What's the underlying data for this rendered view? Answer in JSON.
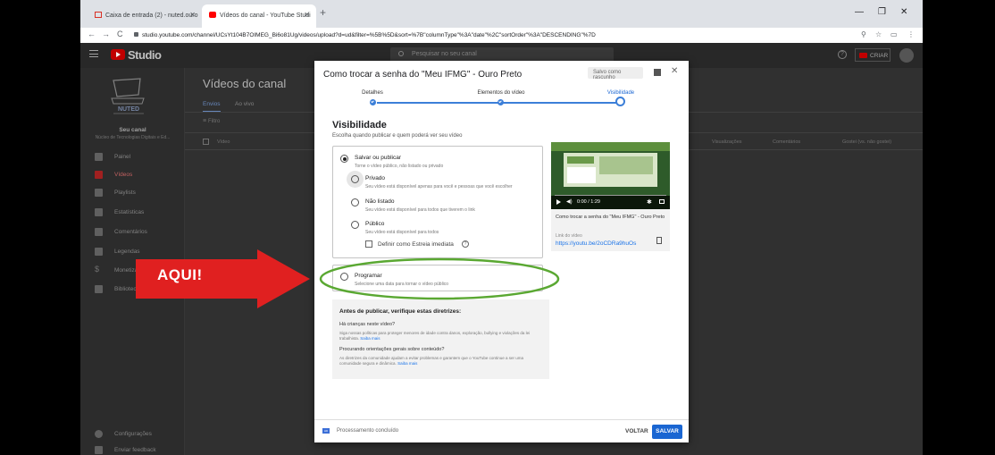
{
  "browser": {
    "tabs": [
      {
        "label": "Caixa de entrada (2) - nuted.ouro"
      },
      {
        "label": "Vídeos do canal - YouTube Studi"
      }
    ],
    "url": "studio.youtube.com/channel/UCsYt104B7OIMEG_Bi6o81Ug/videos/upload?d=ud&filter=%5B%5D&sort=%7B\"columnType\"%3A\"date\"%2C\"sortOrder\"%3A\"DESCENDING\"%7D"
  },
  "studio": {
    "brand": "Studio",
    "search_placeholder": "Pesquisar no seu canal",
    "create_label": "CRIAR"
  },
  "sidebar": {
    "channel_label": "Seu canal",
    "channel_name": "Núcleo de Tecnologias Digitais e Ed...",
    "logo_text": "NUTED",
    "items": [
      {
        "label": "Painel"
      },
      {
        "label": "Vídeos"
      },
      {
        "label": "Playlists"
      },
      {
        "label": "Estatísticas"
      },
      {
        "label": "Comentários"
      },
      {
        "label": "Legendas"
      },
      {
        "label": "Monetização"
      },
      {
        "label": "Biblioteca de áudio"
      }
    ],
    "bottom_items": [
      {
        "label": "Configurações"
      },
      {
        "label": "Enviar feedback"
      }
    ]
  },
  "content": {
    "title": "Vídeos do canal",
    "tabs": [
      {
        "label": "Envios"
      },
      {
        "label": "Ao vivo"
      }
    ],
    "filter_label": "Filtro",
    "columns": [
      "Vídeo",
      "Visualizações",
      "Comentários",
      "Gostei (vs. não gostei)"
    ]
  },
  "dialog": {
    "title": "Como trocar a senha do \"Meu IFMG\" - Ouro Preto",
    "draft_label": "Salvo como rascunho",
    "steps": [
      {
        "label": "Detalhes"
      },
      {
        "label": "Elementos do vídeo"
      },
      {
        "label": "Visibilidade"
      }
    ],
    "heading": "Visibilidade",
    "subheading": "Escolha quando publicar e quem poderá ver seu vídeo",
    "save_publish": {
      "label": "Salvar ou publicar",
      "desc": "Torne o vídeo público, não listado ou privado"
    },
    "options": [
      {
        "label": "Privado",
        "desc": "Seu vídeo está disponível apenas para você e pessoas que você escolher"
      },
      {
        "label": "Não listado",
        "desc": "Seu vídeo está disponível para todos que tiverem o link"
      },
      {
        "label": "Público",
        "desc": "Seu vídeo está disponível para todos"
      }
    ],
    "premiere_label": "Definir como Estreia imediata",
    "schedule": {
      "label": "Programar",
      "desc": "Selecione uma data para tornar o vídeo público"
    },
    "preview": {
      "time": "0:00 / 1:29",
      "title": "Como trocar a senha do \"Meu IFMG\" - Ouro Preto",
      "link_label": "Link do vídeo",
      "link": "https://youtu.be/2oCDRa9huOs"
    },
    "guidelines": {
      "heading": "Antes de publicar, verifique estas diretrizes:",
      "q1": "Há crianças neste vídeo?",
      "t1": "Siga nossas políticas para proteger menores de idade contra danos, exploração, bullying e violações da lei trabalhista.",
      "q2": "Procurando orientações gerais sobre conteúdo?",
      "t2": "As diretrizes da comunidade ajudam a evitar problemas e garantem que o YouTube continue a ser uma comunidade segura e dinâmica.",
      "learn_more": "Saiba mais"
    },
    "footer": {
      "hd": "HD",
      "status": "Processamento concluído",
      "back": "VOLTAR",
      "save": "SALVAR"
    }
  },
  "annotation": {
    "text": "AQUI!",
    "arrow_color": "#e02020",
    "ellipse_color": "#5aa832"
  }
}
